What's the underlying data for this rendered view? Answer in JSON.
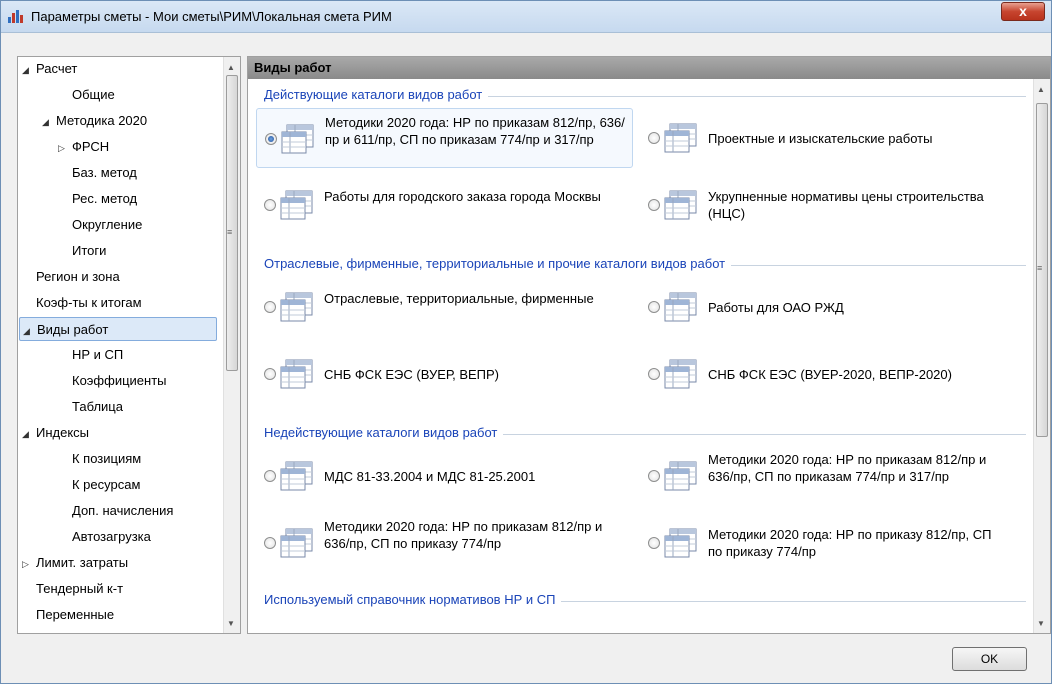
{
  "window": {
    "title": "Параметры сметы - Мои сметы\\РИМ\\Локальная смета РИМ",
    "close_label": "x"
  },
  "tree": {
    "items": [
      {
        "label": "Расчет",
        "level": 0,
        "arrow": "◢"
      },
      {
        "label": "Общие",
        "level": 2,
        "arrow": ""
      },
      {
        "label": "Методика 2020",
        "level": 1,
        "arrow": "◢"
      },
      {
        "label": "ФРСН",
        "level": 2,
        "arrow": "▷"
      },
      {
        "label": "Баз. метод",
        "level": 2,
        "arrow": ""
      },
      {
        "label": "Рес. метод",
        "level": 2,
        "arrow": ""
      },
      {
        "label": "Округление",
        "level": 2,
        "arrow": ""
      },
      {
        "label": "Итоги",
        "level": 2,
        "arrow": ""
      },
      {
        "label": "Регион и зона",
        "level": 0,
        "arrow": ""
      },
      {
        "label": "Коэф-ты к итогам",
        "level": 0,
        "arrow": ""
      },
      {
        "label": "Виды работ",
        "level": 0,
        "arrow": "◢"
      },
      {
        "label": "НР и СП",
        "level": 2,
        "arrow": ""
      },
      {
        "label": "Коэффициенты",
        "level": 2,
        "arrow": ""
      },
      {
        "label": "Таблица",
        "level": 2,
        "arrow": ""
      },
      {
        "label": "Индексы",
        "level": 0,
        "arrow": "◢"
      },
      {
        "label": "К позициям",
        "level": 2,
        "arrow": ""
      },
      {
        "label": "К ресурсам",
        "level": 2,
        "arrow": ""
      },
      {
        "label": "Доп. начисления",
        "level": 2,
        "arrow": ""
      },
      {
        "label": "Автозагрузка",
        "level": 2,
        "arrow": ""
      },
      {
        "label": "Лимит. затраты",
        "level": 0,
        "arrow": "▷"
      },
      {
        "label": "Тендерный к-т",
        "level": 0,
        "arrow": ""
      },
      {
        "label": "Переменные",
        "level": 0,
        "arrow": ""
      }
    ],
    "selected_label": "Виды работ"
  },
  "panel": {
    "header": "Виды работ",
    "sections": [
      {
        "title": "Действующие каталоги видов работ",
        "options": [
          {
            "label": "Методики 2020 года: НР по приказам 812/пр, 636/пр и 611/пр, СП по приказам 774/пр и 317/пр",
            "checked": true
          },
          {
            "label": "Проектные и изыскательские работы",
            "checked": false
          },
          {
            "label": "Работы для городского заказа города Москвы",
            "checked": false
          },
          {
            "label": "Укрупненные нормативы цены строительства (НЦС)",
            "checked": false
          }
        ]
      },
      {
        "title": "Отраслевые, фирменные, территориальные и прочие каталоги видов работ",
        "options": [
          {
            "label": "Отраслевые, территориальные, фирменные",
            "checked": false
          },
          {
            "label": "Работы для ОАО РЖД",
            "checked": false
          },
          {
            "label": "СНБ ФСК ЕЭС (ВУЕР, ВЕПР)",
            "checked": false
          },
          {
            "label": "СНБ ФСК ЕЭС (ВУЕР-2020, ВЕПР-2020)",
            "checked": false
          }
        ]
      },
      {
        "title": "Недействующие каталоги видов работ",
        "options": [
          {
            "label": "МДС 81-33.2004 и МДС 81-25.2001",
            "checked": false
          },
          {
            "label": "Методики 2020 года: НР по приказам 812/пр и 636/пр, СП по приказам 774/пр и 317/пр",
            "checked": false
          },
          {
            "label": "Методики 2020 года: НР по приказам 812/пр и 636/пр, СП по приказу 774/пр",
            "checked": false
          },
          {
            "label": "Методики 2020 года: НР по приказу 812/пр, СП по приказу 774/пр",
            "checked": false
          }
        ]
      },
      {
        "title": "Используемый справочник нормативов НР и СП",
        "options": []
      }
    ]
  },
  "footer": {
    "ok_label": "OK"
  },
  "colors": {
    "section_title": "#1a44b8",
    "selection": "#dce9f8",
    "header_bar": "#8a8a8a"
  }
}
